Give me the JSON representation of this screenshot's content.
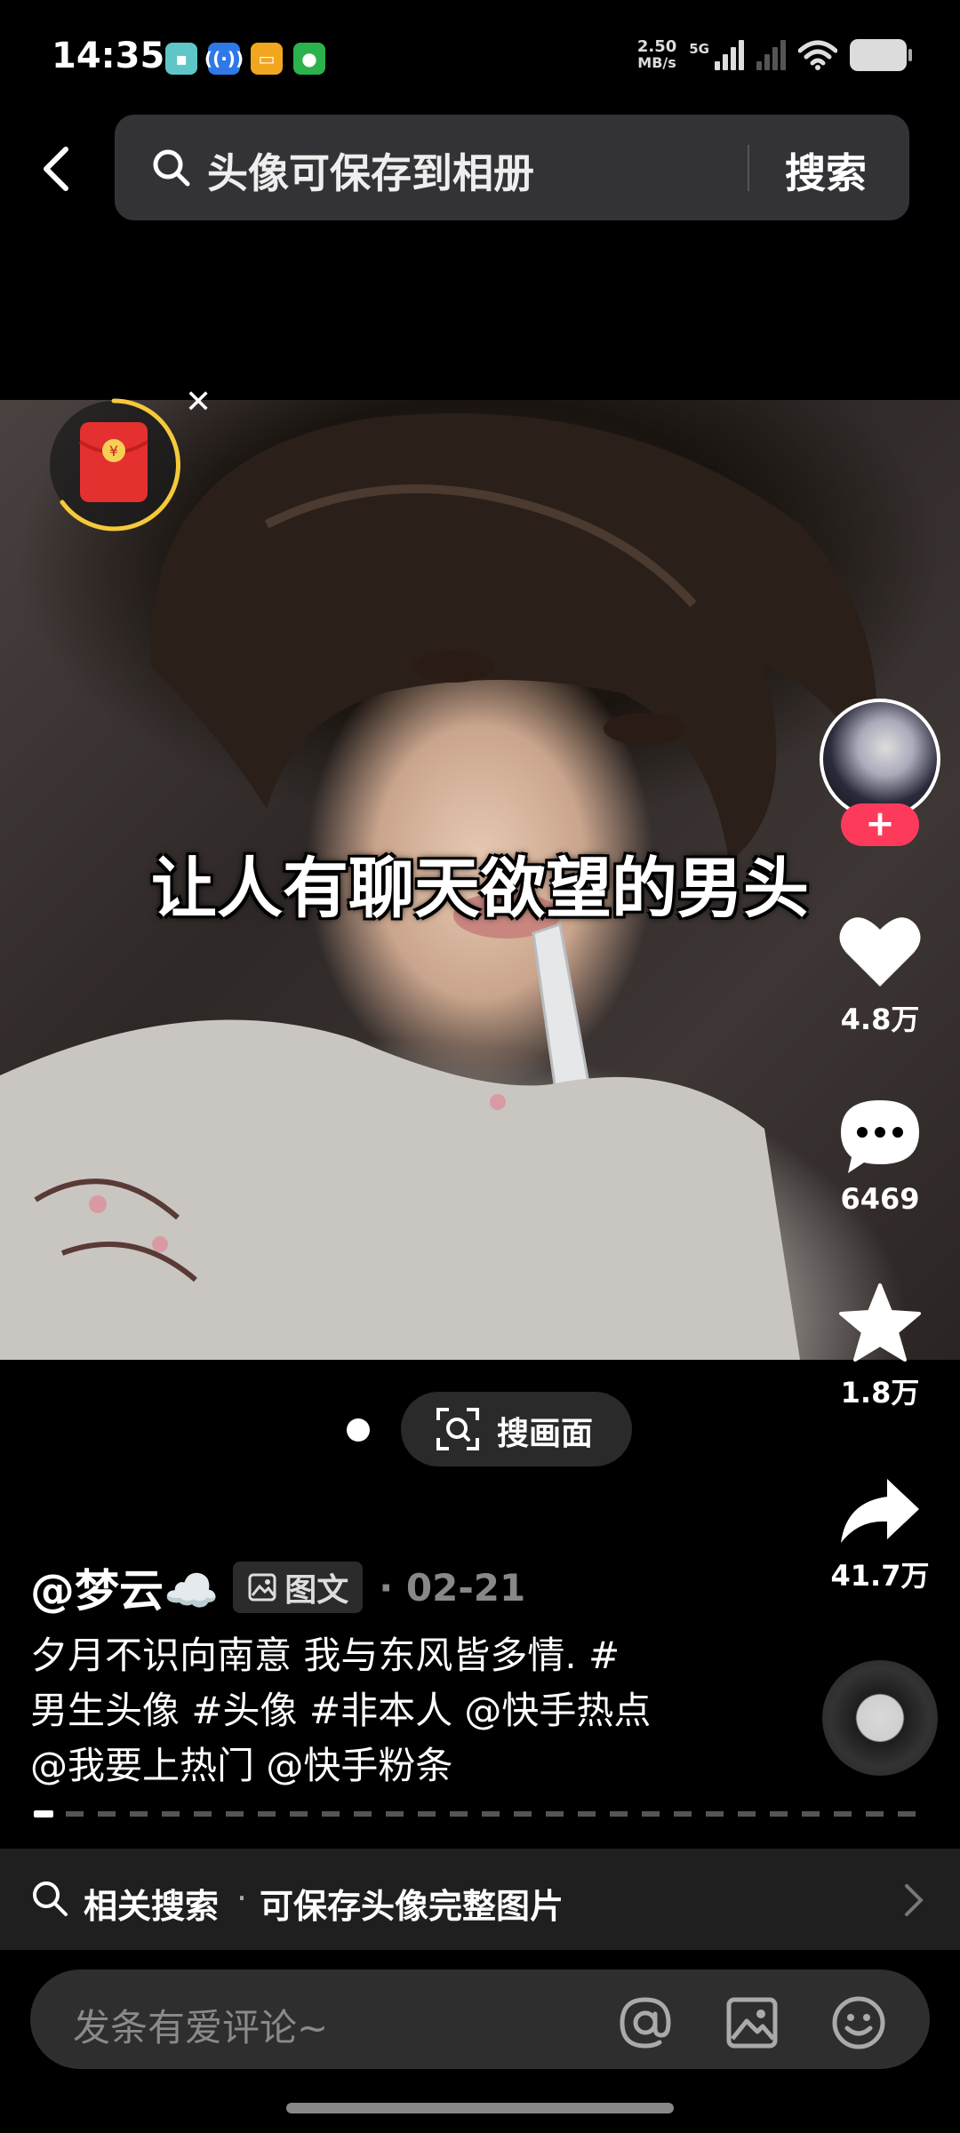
{
  "status_bar": {
    "time": "14:35",
    "net_speed_value": "2.50",
    "net_speed_unit": "MB/s",
    "network_gen": "5G",
    "app_icons": [
      "gallery-icon",
      "hotspot-icon",
      "message-icon",
      "wechat-icon"
    ]
  },
  "search": {
    "query": "头像可保存到相册",
    "button_label": "搜索"
  },
  "photo": {
    "caption": "让人有聊天欲望的男头"
  },
  "actions": {
    "follow_symbol": "+",
    "likes": "4.8万",
    "comments": "6469",
    "favorites": "1.8万",
    "shares": "41.7万"
  },
  "image_search": {
    "label": "搜画面"
  },
  "post": {
    "author": "@梦云☁️",
    "type_label": "图文",
    "date_separator": "·",
    "date": "02-21",
    "description_lines": [
      "夕月不识向南意 我与东风皆多情. #",
      "男生头像 #头像 #非本人 @快手热点",
      "@我要上热门 @快手粉条"
    ]
  },
  "related_search": {
    "label": "相关搜索",
    "separator": "·",
    "term": "可保存头像完整图片"
  },
  "comment_bar": {
    "placeholder": "发条有爱评论~"
  },
  "colors": {
    "background": "#000000",
    "accent_pink": "#fe3a5b",
    "search_bg": "#333337",
    "timer_ring": "#f5c93a"
  }
}
